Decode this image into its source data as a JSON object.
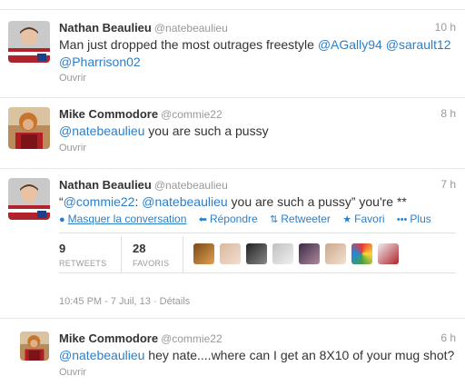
{
  "tweets": [
    {
      "fullname": "Nathan Beaulieu",
      "username": "@natebeaulieu",
      "time": "10 h",
      "text_parts": [
        "Man just dropped the most outrages freestyle ",
        "@AGally94",
        " ",
        "@sarault12",
        " ",
        "@Pharrison02"
      ],
      "open_label": "Ouvrir"
    },
    {
      "fullname": "Mike Commodore",
      "username": "@commie22",
      "time": "8 h",
      "text_parts": [
        "@natebeaulieu",
        " you are such a pussy"
      ],
      "open_label": "Ouvrir"
    },
    {
      "fullname": "Nathan Beaulieu",
      "username": "@natebeaulieu",
      "time": "7 h",
      "text_parts": [
        "“",
        "@commie22",
        ": ",
        "@natebeaulieu",
        " you are such a pussy”  you're **"
      ],
      "actions": {
        "hide_conversation": "Masquer la conversation",
        "reply": "Répondre",
        "retweet": "Retweeter",
        "favorite": "Favori",
        "more": "Plus"
      },
      "stats": {
        "retweets_count": "9",
        "retweets_label": "RETWEETS",
        "favorites_count": "28",
        "favorites_label": "FAVORIS"
      },
      "dateline": "10:45 PM - 7 Juil, 13 · Détails"
    },
    {
      "fullname": "Mike Commodore",
      "username": "@commie22",
      "time": "6 h",
      "text_parts": [
        "@natebeaulieu",
        " hey nate....where can I get an 8X10 of your mug shot?"
      ],
      "open_label": "Ouvrir"
    }
  ],
  "colors": {
    "link": "#2a7fc8",
    "muted": "#999999",
    "text": "#333333",
    "expanded_bg": "#f7f7f7"
  },
  "icons": {
    "hide_conversation": "speech-bubble-icon",
    "reply": "reply-arrow-icon",
    "retweet": "retweet-icon",
    "favorite": "star-icon",
    "more": "more-dots-icon"
  }
}
